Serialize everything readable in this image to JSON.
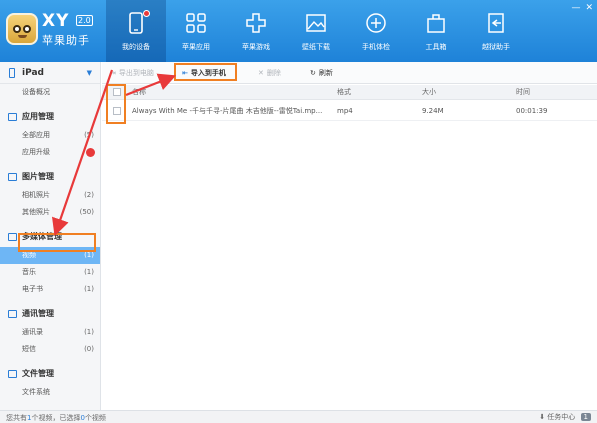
{
  "app": {
    "brand_xy": "XY",
    "version_badge": "2.0",
    "brand_name": "苹果助手",
    "accent_color": "#2a7dd6",
    "highlight_color": "#f07f22",
    "arrow_color": "#e8393a"
  },
  "nav": [
    {
      "label": "我的设备",
      "icon": "phone-icon",
      "active": true
    },
    {
      "label": "苹果应用",
      "icon": "apps-grid-icon"
    },
    {
      "label": "苹果游戏",
      "icon": "gamepad-icon"
    },
    {
      "label": "壁纸下载",
      "icon": "picture-icon"
    },
    {
      "label": "手机体检",
      "icon": "plus-circle-icon"
    },
    {
      "label": "工具箱",
      "icon": "toolbox-icon"
    },
    {
      "label": "越狱助手",
      "icon": "exit-icon"
    }
  ],
  "sidebar": {
    "device": "iPad",
    "device_overview": "设备概况",
    "groups": [
      {
        "title": "应用管理",
        "items": [
          {
            "label": "全部应用",
            "count": "(5)"
          },
          {
            "label": "应用升级",
            "count": ""
          }
        ]
      },
      {
        "title": "图片管理",
        "items": [
          {
            "label": "相机照片",
            "count": "(2)"
          },
          {
            "label": "其他照片",
            "count": "(50)"
          }
        ]
      },
      {
        "title": "多媒体管理",
        "items": [
          {
            "label": "视频",
            "count": "(1)"
          },
          {
            "label": "音乐",
            "count": "(1)"
          },
          {
            "label": "电子书",
            "count": "(1)"
          }
        ]
      },
      {
        "title": "通讯管理",
        "items": [
          {
            "label": "通讯录",
            "count": "(1)"
          },
          {
            "label": "短信",
            "count": "(0)"
          }
        ]
      },
      {
        "title": "文件管理",
        "items": [
          {
            "label": "文件系统",
            "count": ""
          }
        ]
      }
    ]
  },
  "toolbar": {
    "export_label": "导出到电脑",
    "import_label": "导入到手机",
    "delete_label": "删除",
    "refresh_label": "刷新"
  },
  "table": {
    "columns": [
      "名称",
      "格式",
      "大小",
      "时间"
    ],
    "rows": [
      {
        "name": "Always With Me -千与千寻-片尾曲 木吉他版--雷悦Tai.mp...",
        "format": "mp4",
        "size": "9.24M",
        "time": "00:01:39"
      }
    ]
  },
  "status": {
    "prefix": "您共有",
    "total": "1",
    "mid": "个视频，已选择",
    "selected": "0",
    "suffix": "个视频",
    "task_label": "任务中心",
    "task_count": "1"
  }
}
